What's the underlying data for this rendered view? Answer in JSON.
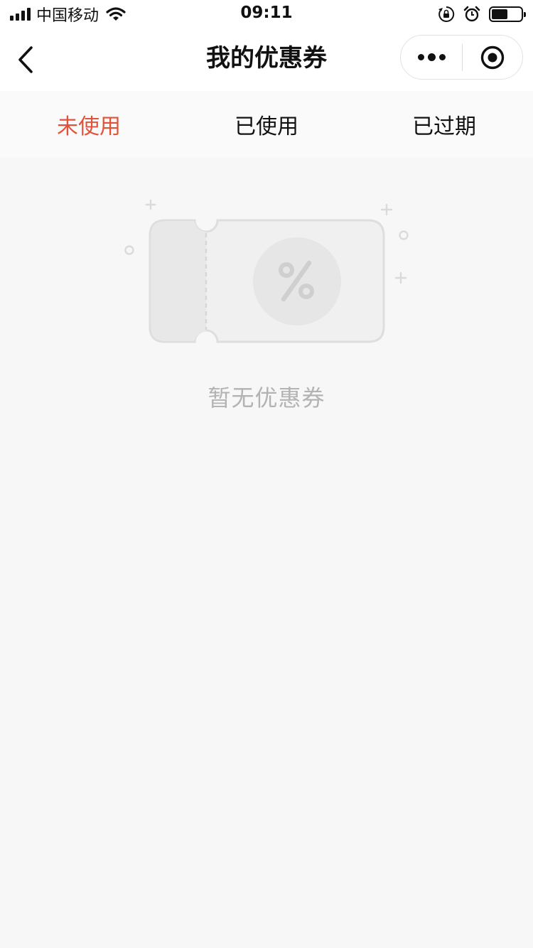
{
  "status_bar": {
    "carrier": "中国移动",
    "time": "09:11",
    "battery_level": 0.55
  },
  "navbar": {
    "title": "我的优惠券"
  },
  "tabs": [
    {
      "label": "未使用",
      "active": true
    },
    {
      "label": "已使用",
      "active": false
    },
    {
      "label": "已过期",
      "active": false
    }
  ],
  "empty_state": {
    "icon": "coupon-percent-icon",
    "message": "暂无优惠券"
  },
  "colors": {
    "accent": "#e0533a",
    "page_bg": "#f7f7f7",
    "muted_text": "#b3b3b3"
  }
}
